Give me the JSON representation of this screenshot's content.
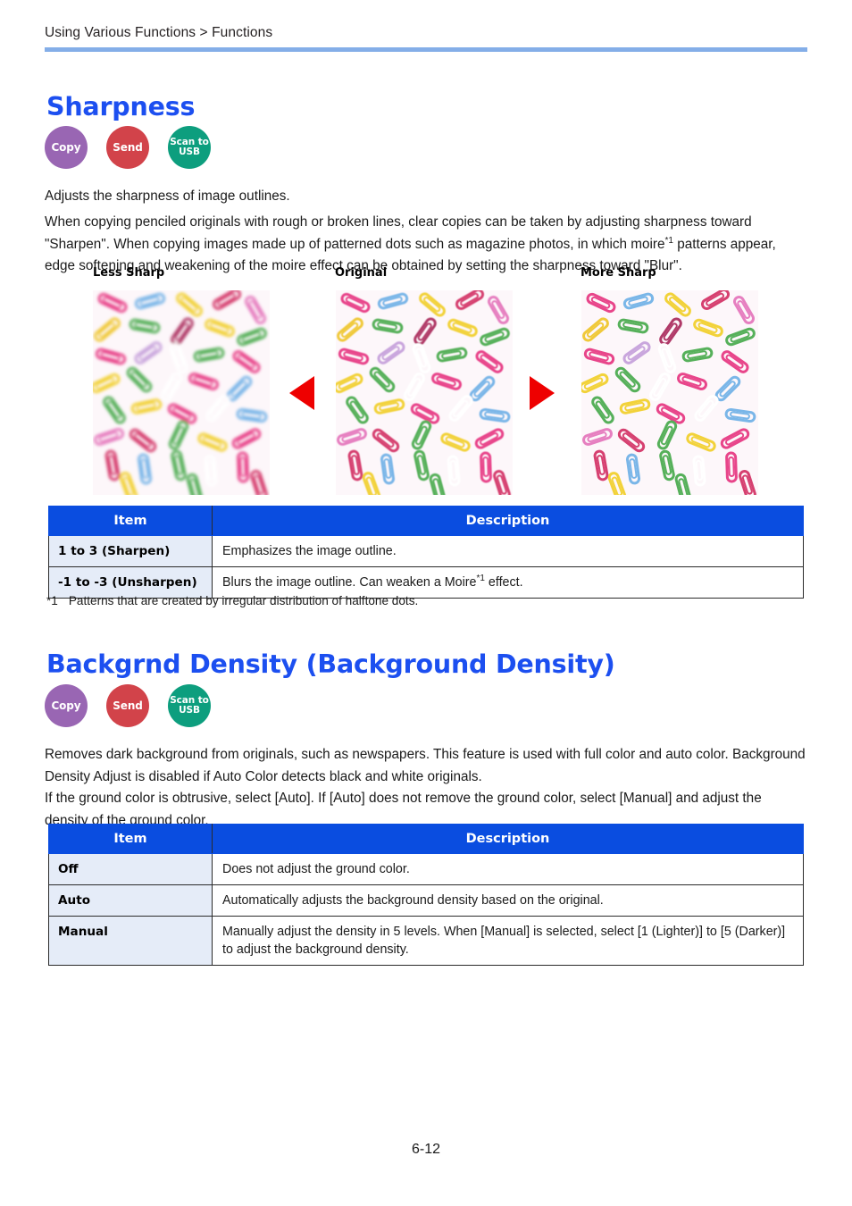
{
  "header": {
    "breadcrumb": "Using Various Functions > Functions",
    "rule_color": "#84aee8"
  },
  "sections": [
    {
      "id": "sharpness",
      "title": "Sharpness",
      "title_color": "#1c4ff0",
      "badges": [
        {
          "label": "Copy",
          "color": "#9966b3",
          "icon": "copy-badge"
        },
        {
          "label": "Send",
          "color": "#d2434a",
          "icon": "send-badge"
        },
        {
          "label": "Scan to USB",
          "line1": "Scan to",
          "line2": "USB",
          "color": "#0d9e7e",
          "icon": "scan-to-usb-badge"
        }
      ],
      "paragraphs": [
        "Adjusts the sharpness of image outlines.",
        "When copying penciled originals with rough or broken lines, clear copies can be taken by adjusting sharpness toward \"Sharpen\". When copying images made up of patterned dots such as magazine photos, in which moire"
      ],
      "paragraph_2_sup": "*1",
      "paragraph_2_tail": " patterns appear, edge softening and weakening of the moire effect can be obtained by setting the sharpness toward \"Blur\".",
      "figure": {
        "captions": [
          "Less Sharp",
          "Original",
          "More Sharp"
        ],
        "arrow_color": "#ee0000",
        "arrows": [
          "triangle-left",
          "triangle-right"
        ],
        "image_subject": "colored paper clips scattered on white background"
      },
      "table": {
        "columns": [
          "Item",
          "Description"
        ],
        "rows": [
          {
            "item": "1 to 3 (Sharpen)",
            "description": "Emphasizes the image outline."
          },
          {
            "item": "-1 to -3 (Unsharpen)",
            "description_pre": "Blurs the image outline. Can weaken a Moire",
            "description_sup": "*1",
            "description_post": " effect."
          }
        ]
      },
      "footnote": {
        "mark": "*1",
        "text": "Patterns that are created by irregular distribution of halftone dots."
      }
    },
    {
      "id": "background-density",
      "title": "Backgrnd Density (Background Density)",
      "title_color": "#1c4ff0",
      "badges": [
        {
          "label": "Copy",
          "color": "#9966b3",
          "icon": "copy-badge"
        },
        {
          "label": "Send",
          "color": "#d2434a",
          "icon": "send-badge"
        },
        {
          "label": "Scan to USB",
          "line1": "Scan to",
          "line2": "USB",
          "color": "#0d9e7e",
          "icon": "scan-to-usb-badge"
        }
      ],
      "paragraphs": [
        "Removes dark background from originals, such as newspapers. This feature is used with full color and auto color. Background Density Adjust is disabled if Auto Color detects black and white originals.",
        "If the ground color is obtrusive, select [Auto]. If [Auto] does not remove the ground color, select [Manual] and adjust the density of the ground color."
      ],
      "table": {
        "columns": [
          "Item",
          "Description"
        ],
        "rows": [
          {
            "item": "Off",
            "description": "Does not adjust the ground color."
          },
          {
            "item": "Auto",
            "description": "Automatically adjusts the background density based on the original."
          },
          {
            "item": "Manual",
            "description": "Manually adjust the density in 5 levels. When [Manual] is selected, select [1 (Lighter)] to [5 (Darker)] to adjust the background density."
          }
        ]
      }
    }
  ],
  "footer": {
    "page_number": "6-12"
  },
  "colors": {
    "heading_blue": "#1c4ff0",
    "table_header_blue": "#0a4de0",
    "item_cell_tint": "#e5ecf8",
    "rule_blue": "#84aee8",
    "arrow_red": "#ee0000"
  }
}
